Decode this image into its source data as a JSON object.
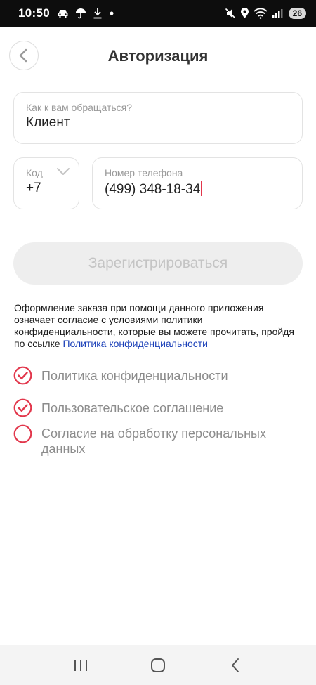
{
  "status_bar": {
    "time": "10:50",
    "battery": "26"
  },
  "header": {
    "title": "Авторизация"
  },
  "form": {
    "name": {
      "label": "Как к вам обращаться?",
      "value": "Клиент"
    },
    "code": {
      "label": "Код",
      "value": "+7"
    },
    "phone": {
      "label": "Номер телефона",
      "value": "(499) 348-18-34"
    },
    "register_label": "Зарегистрироваться"
  },
  "notice": {
    "text": "Оформление заказа при помощи данного приложения означает согласие с условиями политики конфиденциальности, которые вы можете прочитать, пройдя по ссылке ",
    "link": "Политика конфиденциальности"
  },
  "agreements": [
    {
      "label": "Политика конфиденциальности",
      "checked": true
    },
    {
      "label": "Пользовательское соглашение",
      "checked": true
    },
    {
      "label": "Согласие на обработку персональных данных",
      "checked": false
    }
  ],
  "colors": {
    "accent": "#e2364b",
    "muted": "#8c8c8c",
    "link": "#1a3fb8"
  }
}
